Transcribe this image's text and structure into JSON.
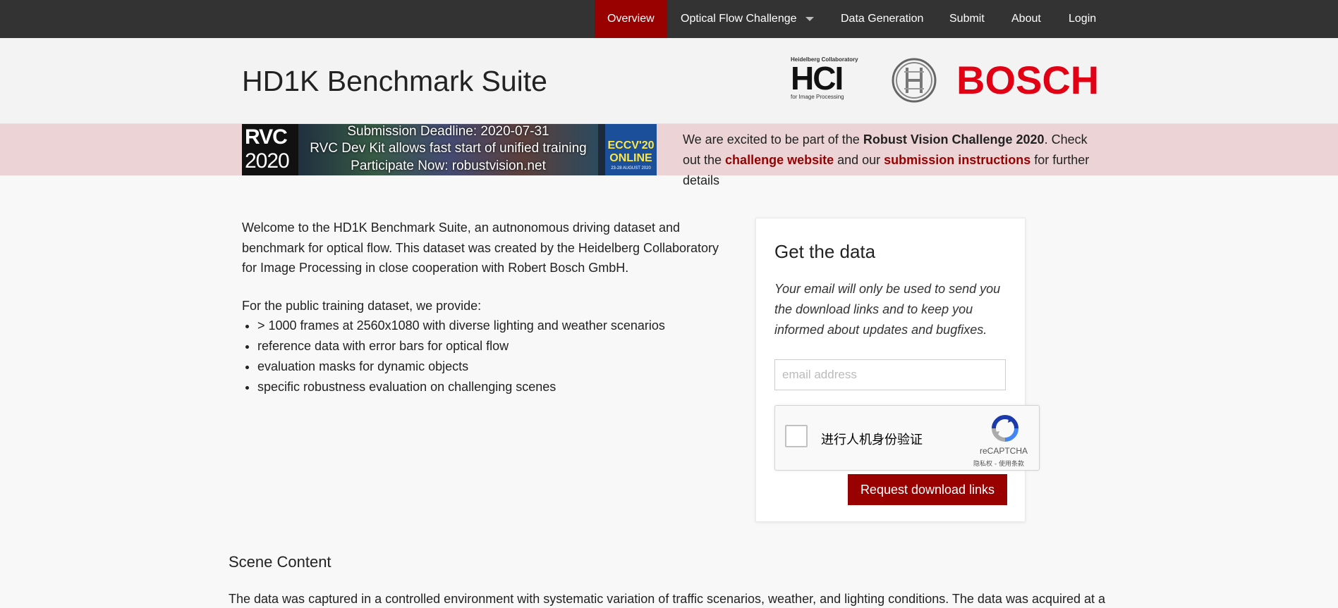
{
  "nav": {
    "items": [
      {
        "label": "Overview",
        "active": true
      },
      {
        "label": "Optical Flow Challenge",
        "dropdown": true
      },
      {
        "label": "Data Generation"
      },
      {
        "label": "Submit"
      },
      {
        "label": "About"
      },
      {
        "label": "Login"
      }
    ]
  },
  "header": {
    "title": "HD1K Benchmark Suite",
    "hci_logo": {
      "top": "Heidelberg Collaboratory",
      "mark": "HCI",
      "bottom": "for Image Processing"
    },
    "bosch_logo": "BOSCH"
  },
  "banner": {
    "image": {
      "left_line1": "RVC",
      "left_line2": "2020",
      "line1": "Submission Deadline: 2020-07-31",
      "line2": "RVC Dev Kit allows fast start of unified training",
      "line3": "Participate Now: robustvision.net",
      "eccv1": "ECCV'20",
      "eccv2": "ONLINE",
      "eccv3": "23-28 AUGUST 2020"
    },
    "text_part1": "We are excited to be part of the ",
    "text_bold": "Robust Vision Challenge 2020",
    "text_part2": ". Check out the ",
    "link1": "challenge website",
    "text_part3": " and our ",
    "link2": "submission instructions",
    "text_part4": " for further details"
  },
  "intro": {
    "paragraph": "Welcome to the HD1K Benchmark Suite, an autnonomous driving dataset and benchmark for optical flow. This dataset was created by the Heidelberg Collaboratory for Image Processing in close cooperation with Robert Bosch GmbH.",
    "list_intro": "For the public training dataset, we provide:",
    "list": [
      "> 1000 frames at 2560x1080 with diverse lighting and weather scenarios",
      "reference data with error bars for optical flow",
      "evaluation masks for dynamic objects",
      "specific robustness evaluation on challenging scenes"
    ]
  },
  "get_data": {
    "title": "Get the data",
    "note": "Your email will only be used to send you the download links and to keep you informed about updates and bugfixes.",
    "email_placeholder": "email address",
    "captcha_label": "进行人机身份验证",
    "captcha_brand": "reCAPTCHA",
    "captcha_links": "隐私权 - 使用条款",
    "button": "Request download links"
  },
  "scene": {
    "heading": "Scene Content",
    "text": "The data was captured in a controlled environment with systematic variation of traffic scenarios, weather, and lighting conditions. The data was acquired at a"
  },
  "colors": {
    "accent": "#990000",
    "nav_bg": "#333333",
    "banner_bg": "#ecd4d6",
    "bosch_red": "#e20015"
  }
}
